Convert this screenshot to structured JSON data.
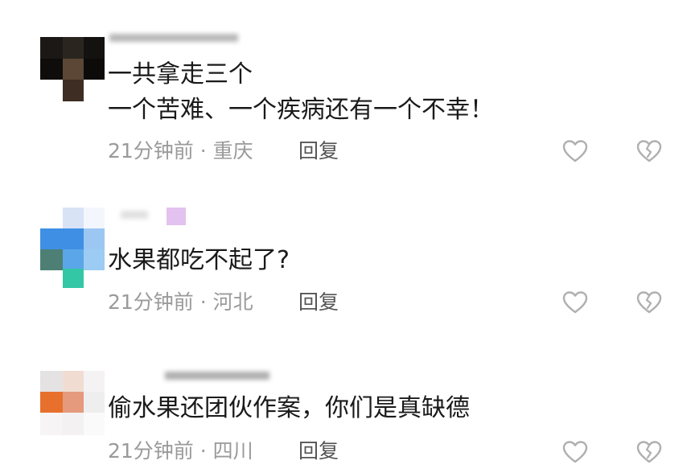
{
  "comments": [
    {
      "lines": [
        "一共拿走三个",
        "一个苦难、一个疾病还有一个不幸！"
      ],
      "time": "21分钟前",
      "location": "重庆",
      "reply_label": "回复",
      "avatar_colors": [
        "#1c1815",
        "#2b2520",
        "#0f0d0b",
        "#5c4636",
        "#8b6a52",
        "#3d2d22"
      ]
    },
    {
      "lines": [
        "水果都吃不起了?"
      ],
      "time": "21分钟前",
      "location": "河北",
      "reply_label": "回复",
      "avatar_colors": [
        "#d9e3f6",
        "#3f8fe4",
        "#9cc7f2",
        "#4d7f74",
        "#5aa6e8",
        "#33c7a5"
      ]
    },
    {
      "lines": [
        "偷水果还团伙作案，你们是真缺德"
      ],
      "time": "21分钟前",
      "location": "四川",
      "reply_label": "回复",
      "avatar_colors": [
        "#e4e2e3",
        "#f1dcd2",
        "#e7702c",
        "#e59a7d",
        "#eeeeee",
        "#f6f4f4"
      ]
    }
  ],
  "separator": "·",
  "icons": {
    "like": "heart-outline-icon",
    "dislike": "broken-heart-icon"
  },
  "colors": {
    "text": "#1a1a1a",
    "meta": "#9a9a9a",
    "reply": "#555555",
    "icon": "#b0b0b0"
  }
}
